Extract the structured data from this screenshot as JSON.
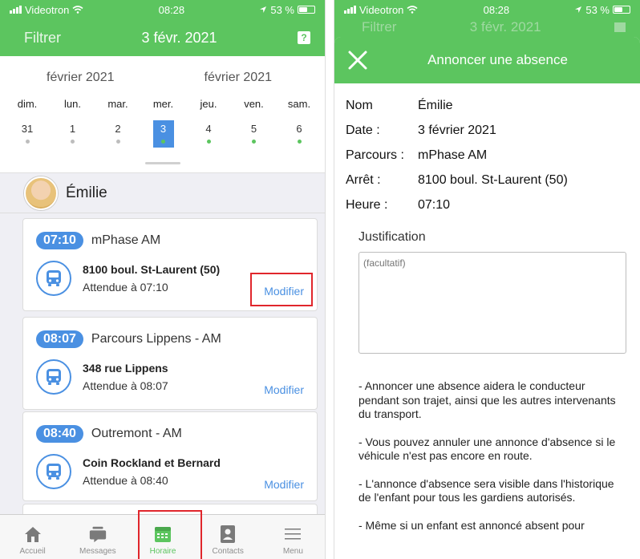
{
  "status": {
    "carrier": "Videotron",
    "time": "08:28",
    "battery": "53 %"
  },
  "left": {
    "header": {
      "filter": "Filtrer",
      "date": "3 févr. 2021",
      "help": "?"
    },
    "calendar": {
      "months": [
        "février 2021",
        "février 2021"
      ],
      "days": [
        {
          "name": "dim.",
          "num": "31",
          "selected": false,
          "dot": "#bdbdbd"
        },
        {
          "name": "lun.",
          "num": "1",
          "selected": false,
          "dot": "#bdbdbd"
        },
        {
          "name": "mar.",
          "num": "2",
          "selected": false,
          "dot": "#bdbdbd"
        },
        {
          "name": "mer.",
          "num": "3",
          "selected": true,
          "dot": "#5cc55f"
        },
        {
          "name": "jeu.",
          "num": "4",
          "selected": false,
          "dot": "#5cc55f"
        },
        {
          "name": "ven.",
          "num": "5",
          "selected": false,
          "dot": "#5cc55f"
        },
        {
          "name": "sam.",
          "num": "6",
          "selected": false,
          "dot": "#5cc55f"
        }
      ]
    },
    "child": {
      "name": "Émilie"
    },
    "trips": [
      {
        "time": "07:10",
        "route": "mPhase AM",
        "stop": "8100 boul. St-Laurent (50)",
        "eta": "Attendue à 07:10",
        "action": "Modifier"
      },
      {
        "time": "08:07",
        "route": "Parcours Lippens - AM",
        "stop": "348 rue Lippens",
        "eta": "Attendue à 08:07",
        "action": "Modifier"
      },
      {
        "time": "08:40",
        "route": "Outremont - AM",
        "stop": "Coin Rockland et Bernard",
        "eta": "Attendue à 08:40",
        "action": "Modifier"
      }
    ],
    "tabs": [
      {
        "label": "Accueil",
        "icon": "home-icon",
        "active": false
      },
      {
        "label": "Messages",
        "icon": "messages-icon",
        "active": false
      },
      {
        "label": "Horaire",
        "icon": "calendar-icon",
        "active": true
      },
      {
        "label": "Contacts",
        "icon": "contacts-icon",
        "active": false
      },
      {
        "label": "Menu",
        "icon": "menu-icon",
        "active": false
      }
    ]
  },
  "right": {
    "under_header": {
      "filter": "Filtrer",
      "date": "3 févr. 2021"
    },
    "modal": {
      "title": "Annoncer une absence",
      "fields": [
        {
          "label": "Nom",
          "value": "Émilie"
        },
        {
          "label": "Date :",
          "value": "3 février 2021"
        },
        {
          "label": "Parcours :",
          "value": "mPhase AM"
        },
        {
          "label": "Arrêt :",
          "value": "8100 boul. St-Laurent (50)"
        },
        {
          "label": "Heure :",
          "value": "07:10"
        }
      ],
      "justification_label": "Justification",
      "justification_placeholder": "(facultatif)",
      "notes": [
        "- Annoncer une absence aidera le conducteur pendant son trajet, ainsi que les autres intervenants du transport.",
        "- Vous pouvez annuler une annonce d'absence si le véhicule n'est pas encore en route.",
        "- L'annonce d'absence sera visible dans l'historique de l'enfant pour tous les gardiens autorisés.",
        "- Même si un enfant est annoncé absent pour"
      ]
    }
  },
  "colors": {
    "brand_green": "#5cc55f",
    "accent_blue": "#4a90e2",
    "highlight_red": "#e0262c"
  }
}
